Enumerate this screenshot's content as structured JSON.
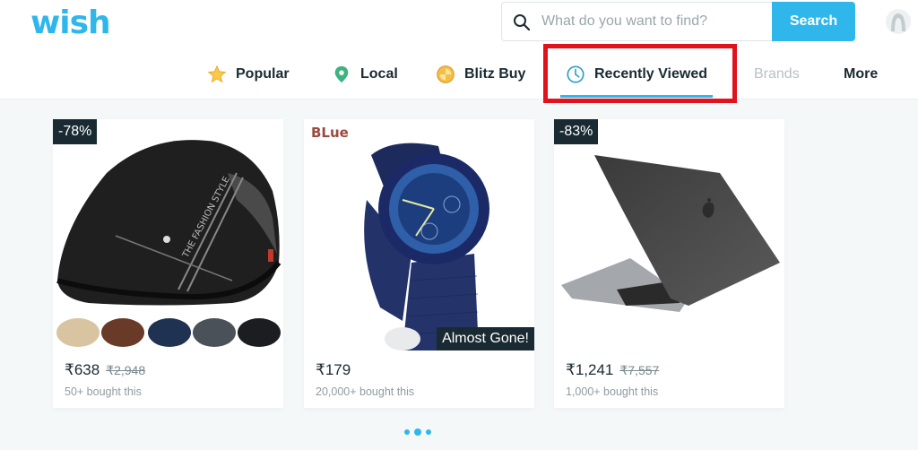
{
  "header": {
    "logo_text": "wish",
    "search": {
      "placeholder": "What do you want to find?",
      "value": "",
      "button_label": "Search"
    },
    "avatar_icon": "user-avatar-icon"
  },
  "nav": {
    "items": [
      {
        "label": "Popular",
        "icon": "star-icon"
      },
      {
        "label": "Local",
        "icon": "location-pin-icon"
      },
      {
        "label": "Blitz Buy",
        "icon": "blitz-coin-icon"
      },
      {
        "label": "Recently Viewed",
        "icon": "clock-icon",
        "active": true
      },
      {
        "label": "Brands"
      },
      {
        "label": "More"
      }
    ]
  },
  "colors": {
    "accent": "#2fb7ec",
    "highlight": "#e1121c",
    "badge_bg": "#192a32"
  },
  "products": [
    {
      "name": "Black flat cap",
      "badge": "-78%",
      "price": "₹638",
      "original_price": "₹2,948",
      "bought": "50+ bought this"
    },
    {
      "name": "Blue military wrist watch",
      "color_label": "BLue",
      "stock_badge": "Almost Gone!",
      "price": "₹179",
      "bought": "20,000+ bought this"
    },
    {
      "name": "Laptop hard shell case",
      "badge": "-83%",
      "price": "₹1,241",
      "original_price": "₹7,557",
      "bought": "1,000+ bought this"
    }
  ],
  "pager": {
    "pages": 3,
    "current": 2
  }
}
